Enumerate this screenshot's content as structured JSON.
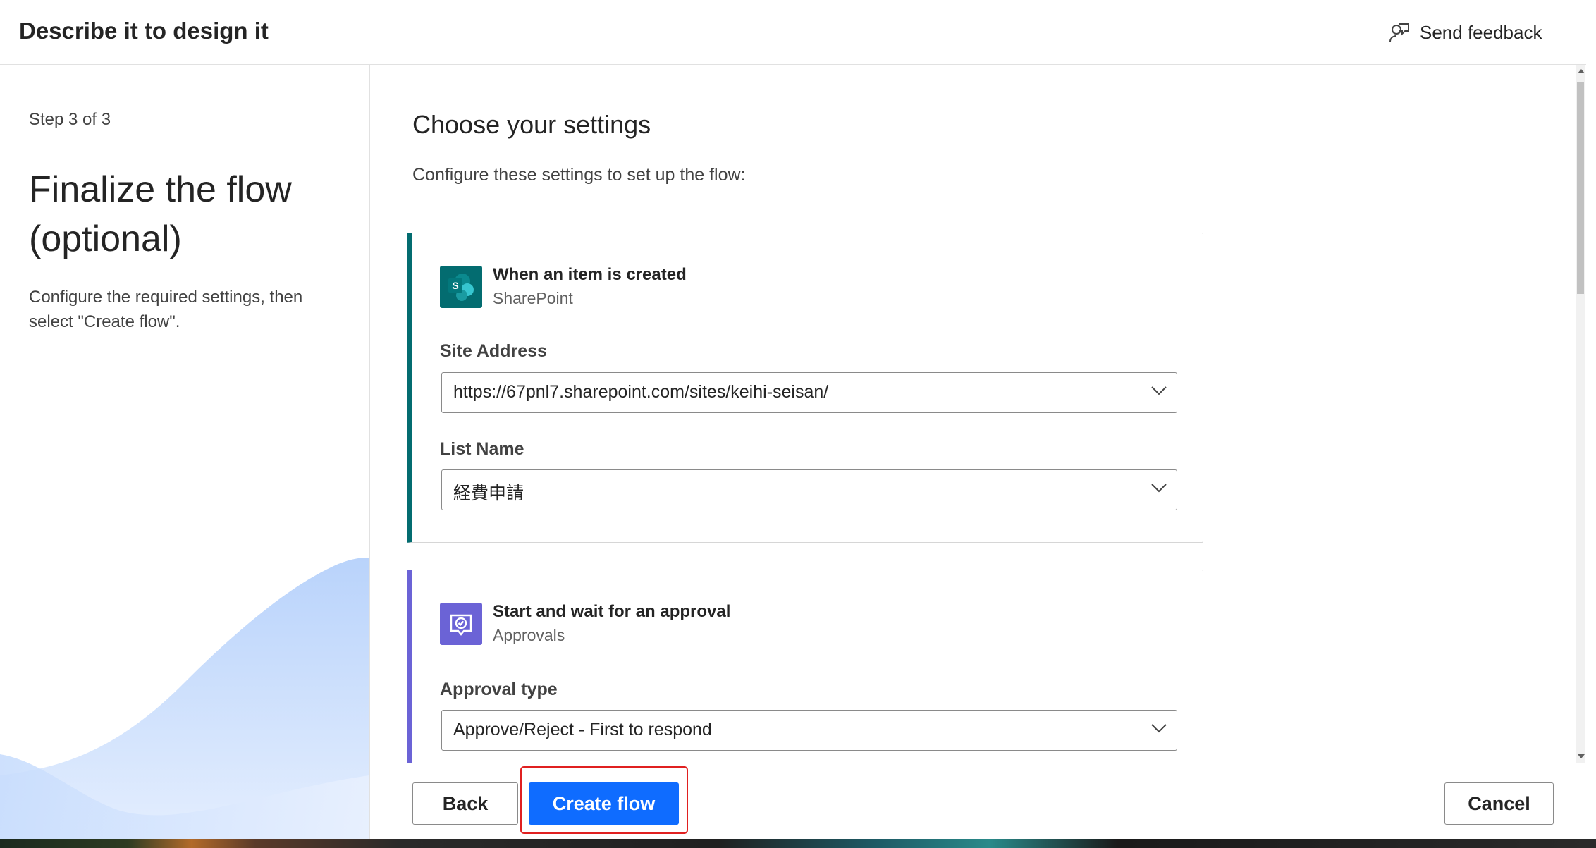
{
  "header": {
    "title": "Describe it to design it",
    "feedback_label": "Send feedback"
  },
  "left": {
    "step": "Step 3 of 3",
    "title": "Finalize the flow (optional)",
    "description": "Configure the required settings, then select \"Create flow\"."
  },
  "main": {
    "title": "Choose your settings",
    "description": "Configure these settings to set up the flow:",
    "cards": [
      {
        "name": "When an item is created",
        "connector": "SharePoint",
        "icon": "sharepoint-icon",
        "accent": "#036c70",
        "fields": [
          {
            "label": "Site Address",
            "value": "https://67pnl7.sharepoint.com/sites/keihi-seisan/"
          },
          {
            "label": "List Name",
            "value": "経費申請"
          }
        ]
      },
      {
        "name": "Start and wait for an approval",
        "connector": "Approvals",
        "icon": "approvals-icon",
        "accent": "#6b63d6",
        "fields": [
          {
            "label": "Approval type",
            "value": "Approve/Reject - First to respond"
          }
        ]
      }
    ]
  },
  "footer": {
    "back_label": "Back",
    "create_label": "Create flow",
    "cancel_label": "Cancel"
  },
  "colors": {
    "primary": "#0f6cff",
    "focus_highlight": "#e02020"
  }
}
